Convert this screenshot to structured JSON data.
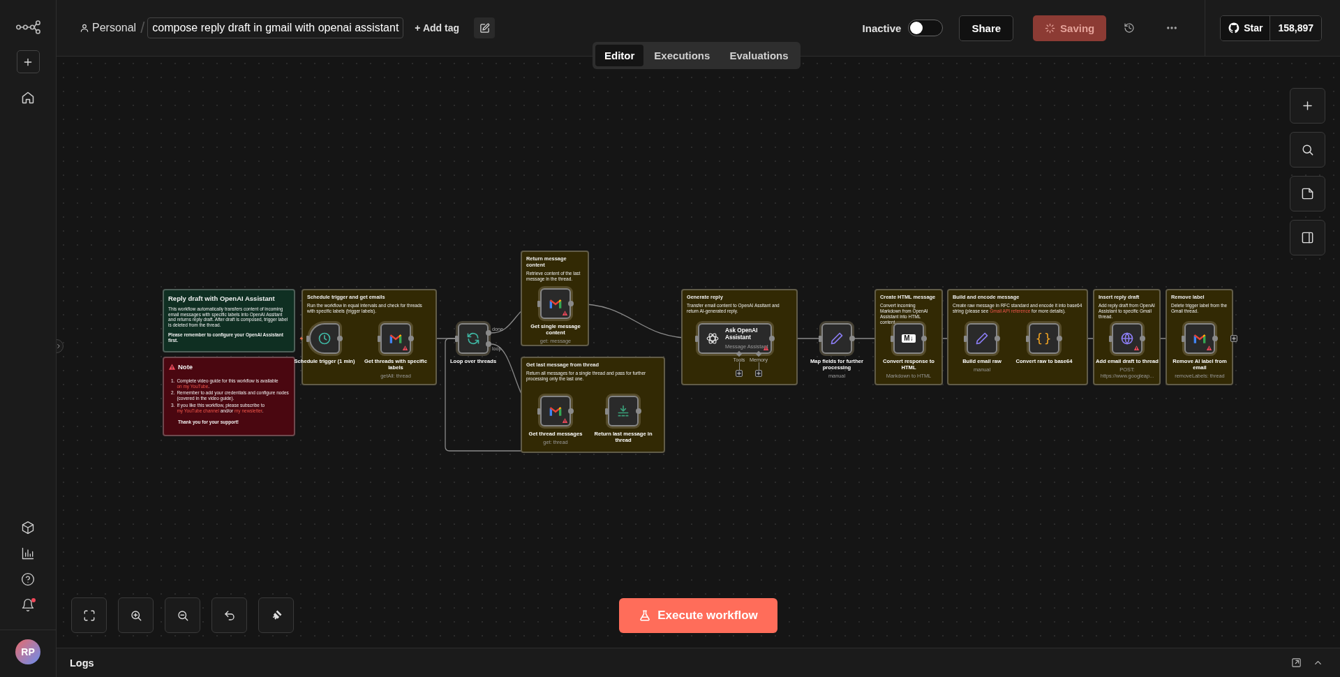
{
  "sidebar": {
    "avatar": "RP",
    "notification": true
  },
  "header": {
    "project": "Personal",
    "separator": "/",
    "workflow_name": "compose reply draft in gmail with openai assistant",
    "add_tag": "+ Add tag",
    "status_label": "Inactive",
    "active": false,
    "share": "Share",
    "save": "Saving",
    "github_star": "Star",
    "github_count": "158,897"
  },
  "view_tabs": [
    {
      "label": "Editor",
      "selected": true
    },
    {
      "label": "Executions",
      "selected": false
    },
    {
      "label": "Evaluations",
      "selected": false
    }
  ],
  "sticky_notes": [
    {
      "kind": "intro",
      "color": "#0f2f22",
      "title": "Reply draft with OpenAI Assistant",
      "paragraphs": [
        {
          "bold": false,
          "segments": [
            {
              "text": "This workflow automatically transfers content of incoming email messages with specific labels into OpenAI Assitant and returns reply draft. After draft is composed, trigger label is deleted from the thread.",
              "link": false
            }
          ]
        },
        {
          "bold": true,
          "segments": [
            {
              "text": "Please remember to configure your OpenAI Assistant first.",
              "link": false
            }
          ]
        }
      ]
    },
    {
      "kind": "note",
      "color": "#4a0710",
      "title": "Note",
      "paragraphs": [
        {
          "number": "1.",
          "bold": false,
          "segments": [
            {
              "text": "Complete video guide for this workflow is available ",
              "link": false
            },
            {
              "text": "on my YouTube",
              "link": true
            },
            {
              "text": ".",
              "link": false
            }
          ]
        },
        {
          "number": "2.",
          "bold": false,
          "segments": [
            {
              "text": "Remember to add your credentials and configure nodes (covered in the video guide).",
              "link": false
            }
          ]
        },
        {
          "number": "3.",
          "bold": false,
          "segments": [
            {
              "text": "If you like this workflow, please subscribe to ",
              "link": false
            },
            {
              "text": "my YouTube channel",
              "link": true
            },
            {
              "text": " and/or ",
              "link": false
            },
            {
              "text": "my newsletter",
              "link": true
            },
            {
              "text": ".",
              "link": false
            }
          ]
        },
        {
          "bold": true,
          "segments": [
            {
              "text": "Thank you for your support!",
              "link": false
            }
          ]
        }
      ]
    },
    {
      "kind": "group",
      "color": "#322904",
      "title": "Schedule trigger and get emails",
      "paragraphs": [
        {
          "bold": false,
          "segments": [
            {
              "text": "Run the workflow in equal intervals and check for threads with specific labels (trigger labels).",
              "link": false
            }
          ]
        }
      ]
    },
    {
      "kind": "group",
      "color": "#322904",
      "title": "Return message content",
      "paragraphs": [
        {
          "bold": false,
          "segments": [
            {
              "text": "Retrieve content of the last message in the thread.",
              "link": false
            }
          ]
        }
      ]
    },
    {
      "kind": "group",
      "color": "#322904",
      "title": "Get last message from thread",
      "paragraphs": [
        {
          "bold": false,
          "segments": [
            {
              "text": "Return all messages for a single thread and pass for further processing only the last one.",
              "link": false
            }
          ]
        }
      ]
    },
    {
      "kind": "group",
      "color": "#322904",
      "title": "Generate reply",
      "paragraphs": [
        {
          "bold": false,
          "segments": [
            {
              "text": "Transfer email content to OpenAI Assitant and return AI-generated reply.",
              "link": false
            }
          ]
        }
      ]
    },
    {
      "kind": "group",
      "color": "#322904",
      "title": "Create HTML message",
      "paragraphs": [
        {
          "bold": false,
          "segments": [
            {
              "text": "Convert incoming Markdown from OpenAI Assistant into HTML content.",
              "link": false
            }
          ]
        }
      ]
    },
    {
      "kind": "group",
      "color": "#322904",
      "title": "Build and encode message",
      "paragraphs": [
        {
          "bold": false,
          "segments": [
            {
              "text": "Create raw message in RFC standard and encode it into base64 string (please see ",
              "link": false
            },
            {
              "text": "Gmail API reference",
              "link": true
            },
            {
              "text": " for more details).",
              "link": false
            }
          ]
        }
      ]
    },
    {
      "kind": "group",
      "color": "#322904",
      "title": "Insert reply draft",
      "paragraphs": [
        {
          "bold": false,
          "segments": [
            {
              "text": "Add reply draft from OpenAI Assistant to specific Gmail thread.",
              "link": false
            }
          ]
        }
      ]
    },
    {
      "kind": "group",
      "color": "#322904",
      "title": "Remove label",
      "paragraphs": [
        {
          "bold": false,
          "segments": [
            {
              "text": "Delete trigger label from the Gmail thread.",
              "link": false
            }
          ]
        }
      ]
    }
  ],
  "nodes": [
    {
      "kind": "schedule",
      "name": "Schedule trigger (1 min)",
      "issues": false
    },
    {
      "kind": "gmail",
      "name": "Get threads with specific labels",
      "subtitle": "getAll: thread",
      "issues": true
    },
    {
      "kind": "loop",
      "name": "Loop over threads",
      "issues": false,
      "outputs": [
        {
          "label": "done"
        },
        {
          "label": "loop"
        }
      ]
    },
    {
      "kind": "gmail",
      "name": "Get single message content",
      "subtitle": "get: message",
      "issues": true
    },
    {
      "kind": "gmail",
      "name": "Get thread messages",
      "subtitle": "get: thread",
      "issues": true
    },
    {
      "kind": "limit",
      "name": "Return last message in thread",
      "issues": false
    },
    {
      "kind": "assistant",
      "name": "Ask OpenAI Assistant",
      "subtitle": "Message Assistant",
      "issues": true,
      "sub_ports": [
        {
          "label": "Tools"
        },
        {
          "label": "Memory"
        }
      ]
    },
    {
      "kind": "set",
      "name": "Map fields for further processing",
      "subtitle": "manual",
      "issues": false
    },
    {
      "kind": "markdown",
      "name": "Convert response to HTML",
      "subtitle": "Markdown to HTML",
      "badge": "M↓",
      "issues": false
    },
    {
      "kind": "set",
      "name": "Build email raw",
      "subtitle": "manual",
      "issues": false
    },
    {
      "kind": "code",
      "name": "Convert raw to base64",
      "badge": "{}",
      "issues": false
    },
    {
      "kind": "http",
      "name": "Add email draft to thread",
      "subtitle": "POST: https://www.googleap...",
      "issues": true
    },
    {
      "kind": "gmail",
      "name": "Remove AI label from email",
      "subtitle": "removeLabels: thread",
      "issues": true
    }
  ],
  "execute_button": "Execute workflow",
  "logs": {
    "title": "Logs"
  }
}
